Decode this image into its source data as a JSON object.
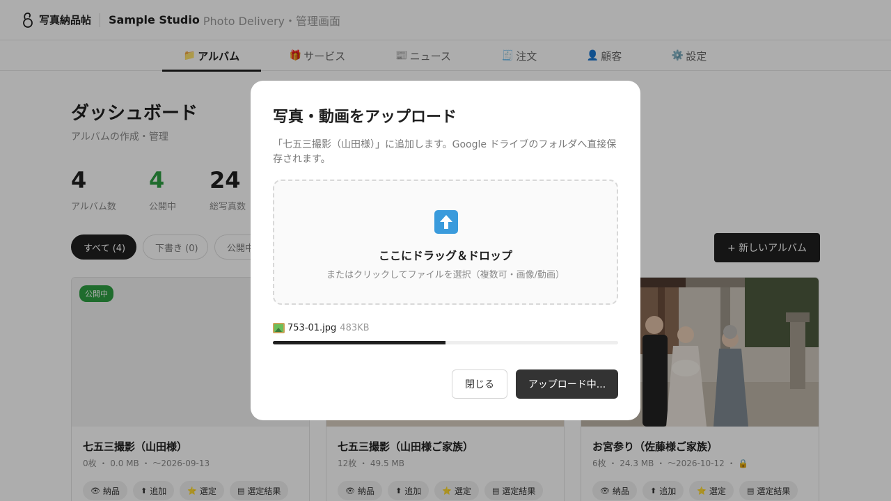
{
  "header": {
    "brand": "写真納品帖",
    "studio_name": "Sample Studio",
    "studio_sub": "Photo Delivery・管理画面"
  },
  "tabs": [
    {
      "icon": "📁",
      "icon_name": "folder-icon",
      "label": "アルバム",
      "active": true
    },
    {
      "icon": "🎁",
      "icon_name": "gift-icon",
      "label": "サービス"
    },
    {
      "icon": "📰",
      "icon_name": "newspaper-icon",
      "label": "ニュース"
    },
    {
      "icon": "🧾",
      "icon_name": "receipt-icon",
      "label": "注文"
    },
    {
      "icon": "👤",
      "icon_name": "person-icon",
      "label": "顧客"
    },
    {
      "icon": "⚙️",
      "icon_name": "gear-icon",
      "label": "設定"
    }
  ],
  "dashboard": {
    "title": "ダッシュボード",
    "subtitle": "アルバムの作成・管理",
    "stats": [
      {
        "value": "4",
        "label": "アルバム数"
      },
      {
        "value": "4",
        "label": "公開中"
      },
      {
        "value": "24",
        "label": "総写真数"
      }
    ],
    "filters": [
      "すべて (4)",
      "下書き (0)",
      "公開中"
    ],
    "new_album_label": "+ 新しいアルバム"
  },
  "albums": [
    {
      "badge": "公開中",
      "title": "七五三撮影（山田様）",
      "meta": "0枚 ・ 0.0 MB ・ 〜2026-09-13"
    },
    {
      "title": "七五三撮影（山田様ご家族）",
      "meta": "12枚 ・ 49.5 MB"
    },
    {
      "title": "お宮参り（佐藤様ご家族）",
      "meta": "6枚 ・ 24.3 MB ・ 〜2026-10-12 ・ 🔒"
    }
  ],
  "card_actions": [
    {
      "icon": "👁",
      "label": "納品"
    },
    {
      "icon": "⬆",
      "label": "追加"
    },
    {
      "icon": "⭐",
      "label": "選定"
    },
    {
      "icon": "▤",
      "label": "選定結果"
    }
  ],
  "modal": {
    "title": "写真・動画をアップロード",
    "description": "「七五三撮影（山田様）」に追加します。Google ドライブのフォルダへ直接保存されます。",
    "dropzone_main": "ここにドラッグ＆ドロップ",
    "dropzone_sub": "またはクリックしてファイルを選択（複数可・画像/動画）",
    "file_name": "753-01.jpg",
    "file_size": "483KB",
    "progress": 0.5,
    "close_label": "閉じる",
    "upload_label": "アップロード中..."
  }
}
